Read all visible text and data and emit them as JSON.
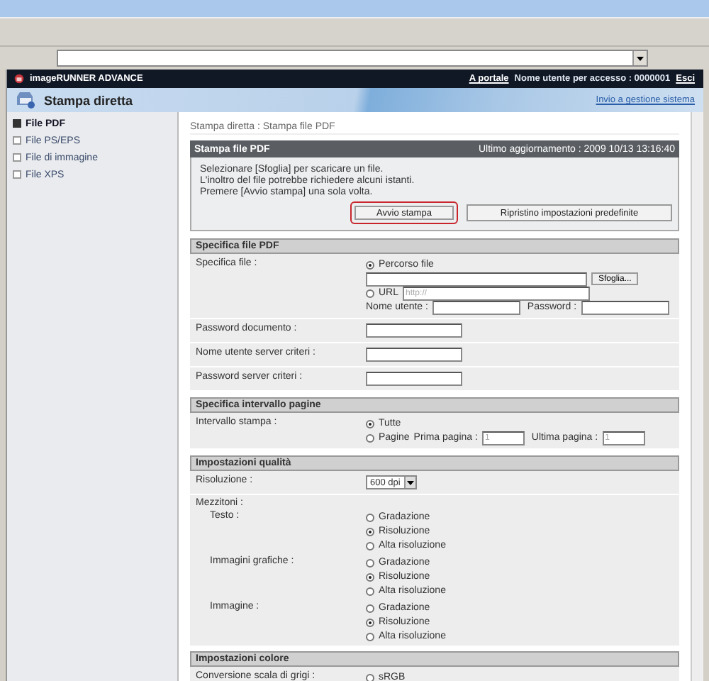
{
  "header": {
    "product": "imageRUNNER ADVANCE",
    "portal_link": "A portale",
    "user_label": "Nome utente per accesso : 0000001",
    "logout": "Esci"
  },
  "banner": {
    "title": "Stampa diretta",
    "link": "Invio a gestione sistema"
  },
  "sidebar": {
    "items": [
      {
        "label": "File PDF",
        "selected": true
      },
      {
        "label": "File PS/EPS",
        "selected": false
      },
      {
        "label": "File di immagine",
        "selected": false
      },
      {
        "label": "File XPS",
        "selected": false
      }
    ]
  },
  "breadcrumb": "Stampa diretta : Stampa file PDF",
  "panel": {
    "title": "Stampa file PDF",
    "updated": "Ultimo aggiornamento : 2009 10/13 13:16:40",
    "instructions": [
      "Selezionare [Sfoglia] per scaricare un file.",
      "L'inoltro del file potrebbe richiedere alcuni istanti.",
      "Premere [Avvio stampa] una sola volta."
    ],
    "buttons": [
      {
        "label": "Avvio stampa",
        "highlighted": true
      },
      {
        "label": "Ripristino impostazioni predefinite",
        "highlighted": false
      }
    ]
  },
  "sections": [
    {
      "title": "Specifica file PDF",
      "rows": [
        {
          "kind": "file",
          "label": "Specifica file :",
          "path_option": {
            "label": "Percorso file",
            "selected": true
          },
          "browse_button": "Sfoglia...",
          "url_option": {
            "label": "URL",
            "selected": false,
            "placeholder": "http://"
          },
          "user_label": "Nome utente :",
          "password_label": "Password :"
        },
        {
          "kind": "text",
          "label": "Password documento :"
        },
        {
          "kind": "text",
          "label": "Nome utente server criteri :"
        },
        {
          "kind": "text",
          "label": "Password server criteri :"
        }
      ]
    },
    {
      "title": "Specifica intervallo pagine",
      "rows": [
        {
          "kind": "range",
          "label": "Intervallo stampa :",
          "all_option": {
            "label": "Tutte",
            "selected": true
          },
          "pages_option": {
            "label": "Pagine",
            "selected": false
          },
          "first_label": "Prima pagina :",
          "first_value": "1",
          "last_label": "Ultima pagina :",
          "last_value": "1"
        }
      ]
    },
    {
      "title": "Impostazioni qualità",
      "rows": [
        {
          "kind": "select",
          "label": "Risoluzione :",
          "value": "600 dpi"
        },
        {
          "kind": "group",
          "label": "Mezzitoni :",
          "children": [
            {
              "kind": "radio",
              "label": "Testo :",
              "options": [
                {
                  "label": "Gradazione",
                  "selected": false
                },
                {
                  "label": "Risoluzione",
                  "selected": true
                },
                {
                  "label": "Alta risoluzione",
                  "selected": false
                }
              ]
            },
            {
              "kind": "radio",
              "label": "Immagini grafiche :",
              "options": [
                {
                  "label": "Gradazione",
                  "selected": false
                },
                {
                  "label": "Risoluzione",
                  "selected": true
                },
                {
                  "label": "Alta risoluzione",
                  "selected": false
                }
              ]
            },
            {
              "kind": "radio",
              "label": "Immagine :",
              "options": [
                {
                  "label": "Gradazione",
                  "selected": false
                },
                {
                  "label": "Risoluzione",
                  "selected": true
                },
                {
                  "label": "Alta risoluzione",
                  "selected": false
                }
              ]
            }
          ]
        }
      ]
    },
    {
      "title": "Impostazioni colore",
      "rows": [
        {
          "kind": "radio",
          "label": "Conversione scala di grigi :",
          "options": [
            {
              "label": "sRGB",
              "selected": false
            }
          ]
        }
      ]
    }
  ]
}
